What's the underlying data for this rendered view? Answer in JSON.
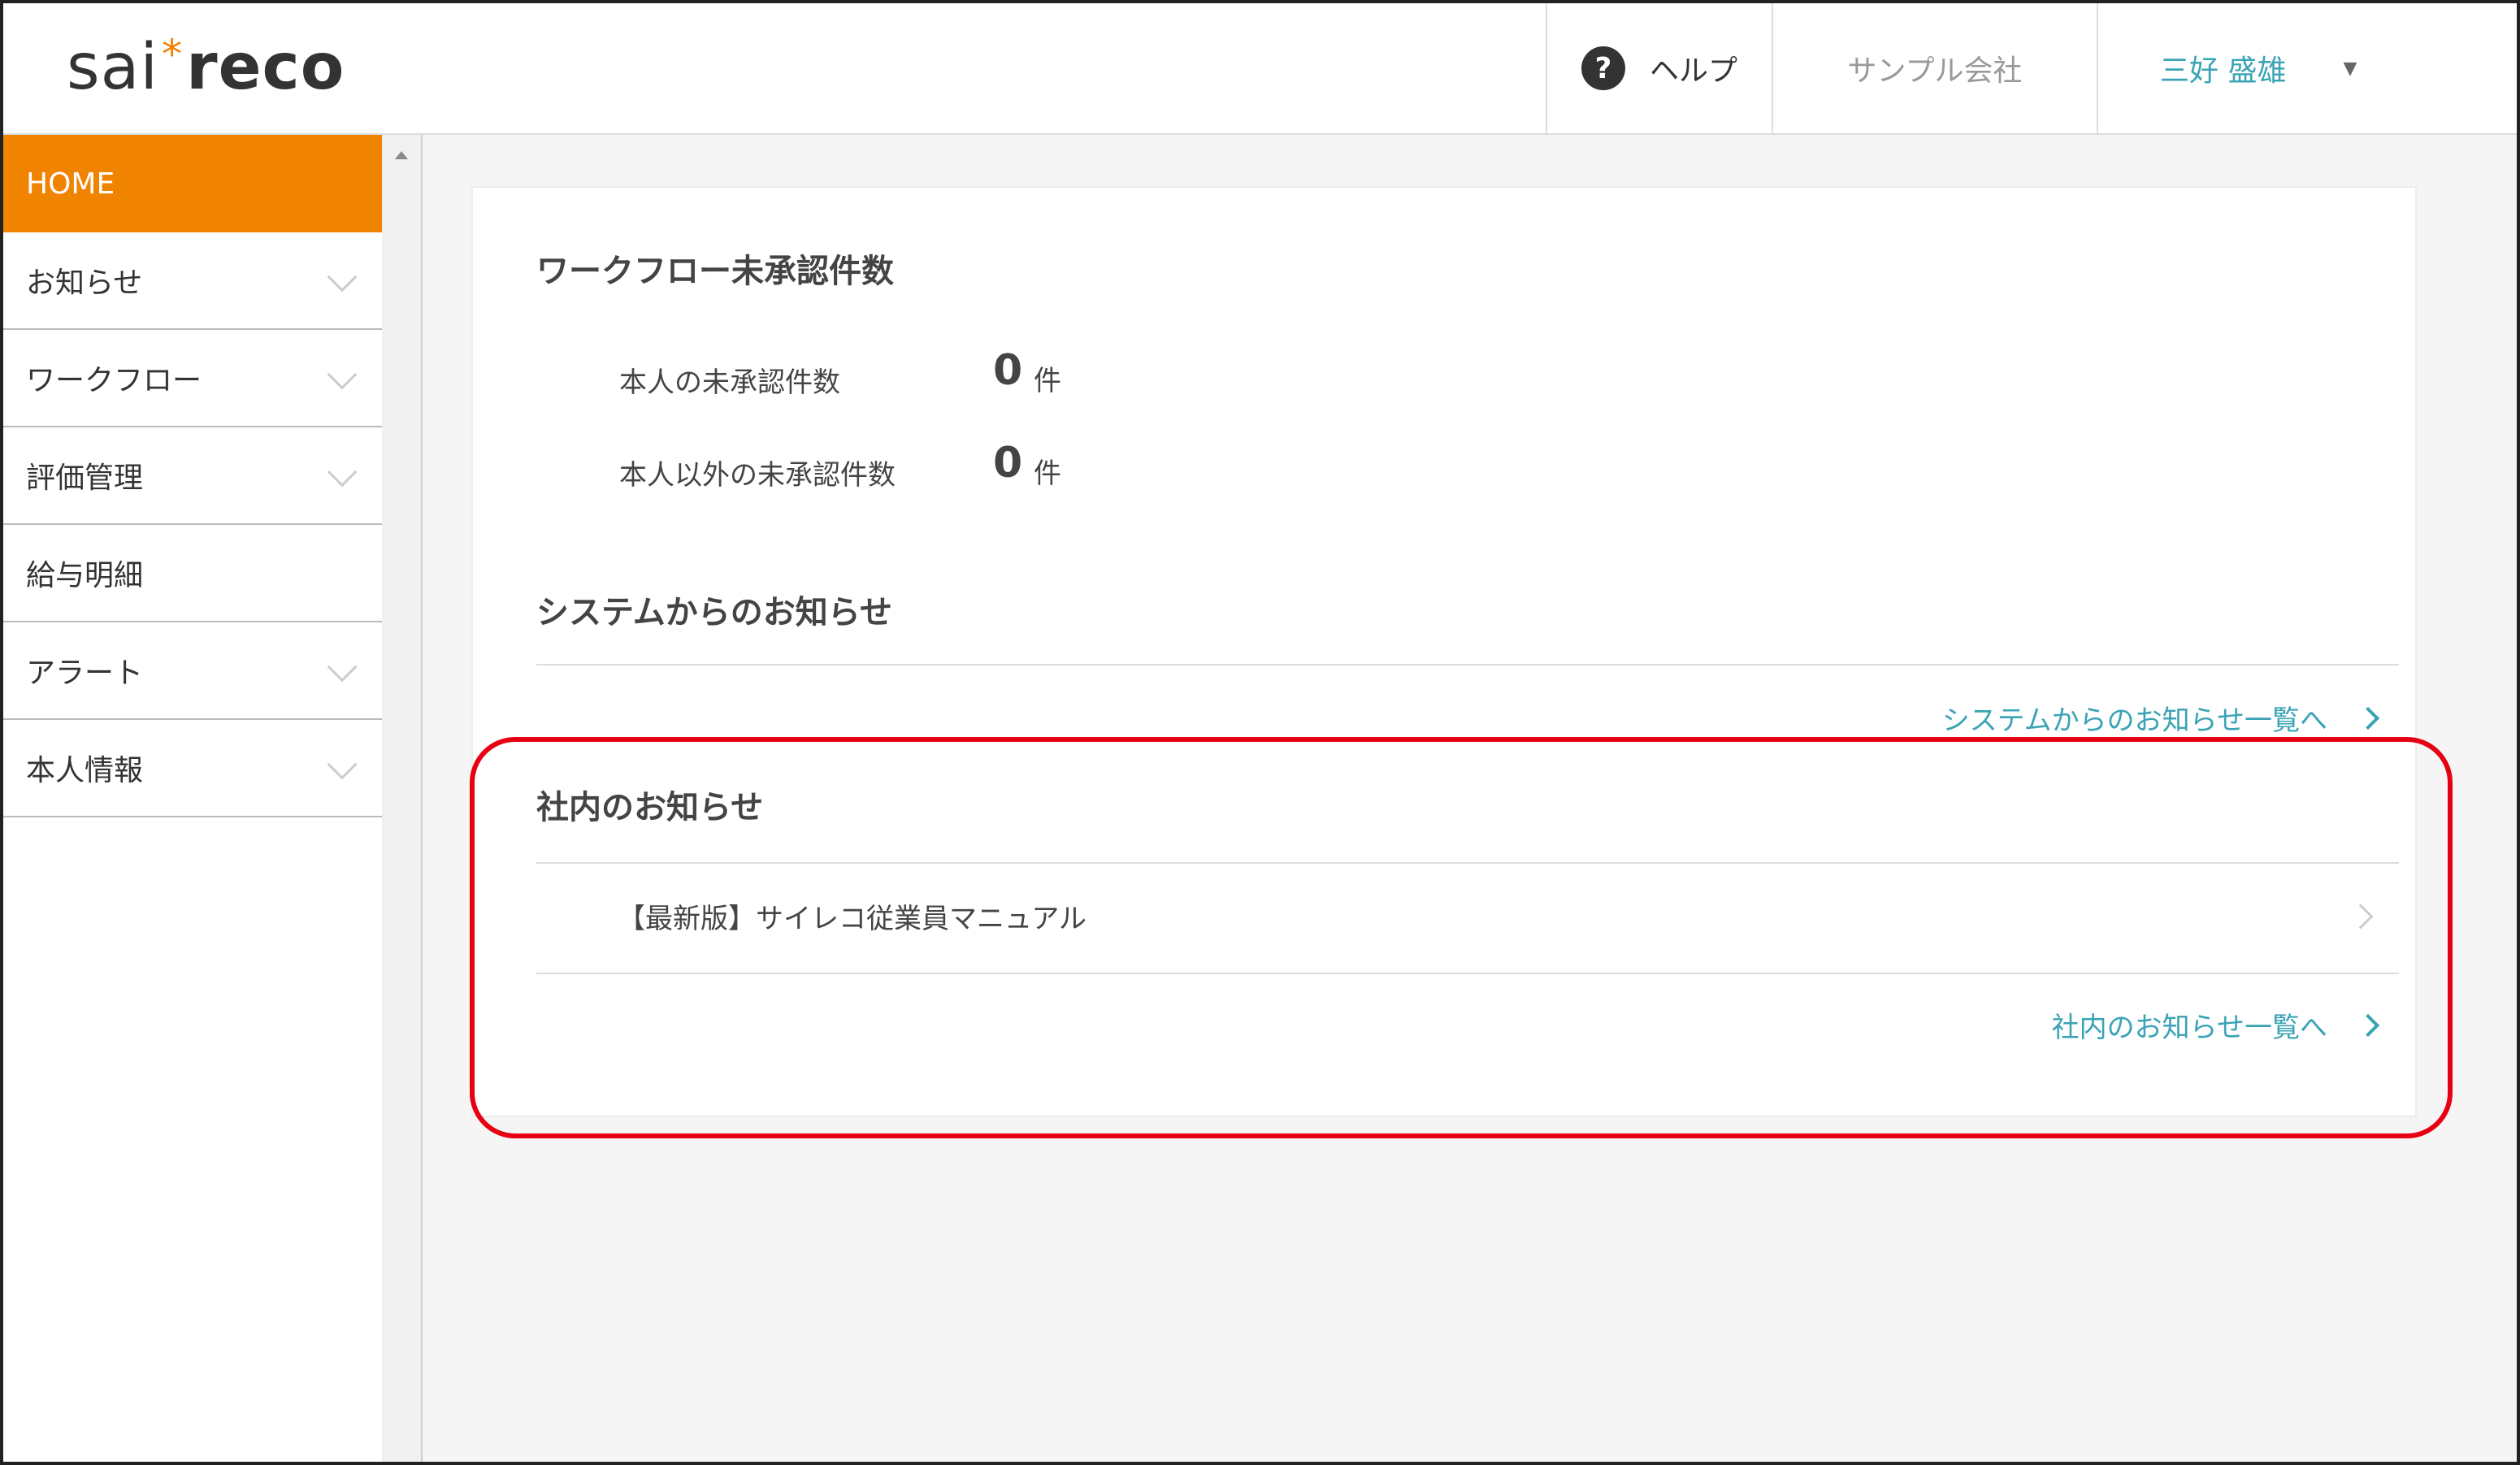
{
  "header": {
    "logo": {
      "part1": "sai",
      "star": "*",
      "part2": "reco"
    },
    "help_icon": "?",
    "help_label": "ヘルプ",
    "company": "サンプル会社",
    "user": "三好 盛雄",
    "user_caret": "▼"
  },
  "sidebar": {
    "items": [
      {
        "label": "HOME",
        "active": true,
        "expandable": false
      },
      {
        "label": "お知らせ",
        "expandable": true
      },
      {
        "label": "ワークフロー",
        "expandable": true
      },
      {
        "label": "評価管理",
        "expandable": true
      },
      {
        "label": "給与明細",
        "expandable": false
      },
      {
        "label": "アラート",
        "expandable": true
      },
      {
        "label": "本人情報",
        "expandable": true
      }
    ]
  },
  "workflow": {
    "title": "ワークフロー未承認件数",
    "self_label": "本人の未承認件数",
    "self_count": "0",
    "others_label": "本人以外の未承認件数",
    "others_count": "0",
    "unit": "件"
  },
  "system_notice": {
    "title": "システムからのお知らせ",
    "more_link": "システムからのお知らせ一覧へ"
  },
  "company_notice": {
    "title": "社内のお知らせ",
    "items": [
      {
        "text": "【最新版】サイレコ従業員マニュアル"
      }
    ],
    "more_link": "社内のお知らせ一覧へ"
  },
  "colors": {
    "accent": "#f08300",
    "link": "#3aa3b5",
    "highlight": "#e60012"
  }
}
